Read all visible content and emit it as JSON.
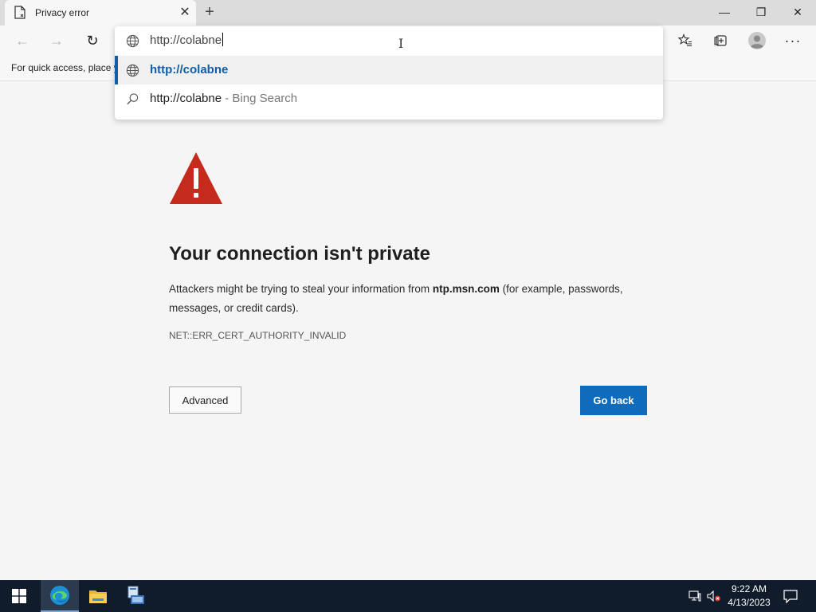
{
  "tab": {
    "title": "Privacy error",
    "close": "✕",
    "new_tab": "+"
  },
  "window": {
    "minimize": "—",
    "restore": "❐",
    "close": "✕"
  },
  "toolbar": {
    "back": "←",
    "forward": "→",
    "refresh": "↻",
    "more": "···"
  },
  "address_bar": {
    "value": "http://colabne"
  },
  "suggestions": [
    {
      "text": "http://colabne",
      "suffix": "",
      "type": "url",
      "selected": true
    },
    {
      "text": "http://colabne",
      "suffix": " - Bing Search",
      "type": "search",
      "selected": false
    }
  ],
  "favorites_bar": {
    "text": "For quick access, place y"
  },
  "page": {
    "headline": "Your connection isn't private",
    "desc_before": "Attackers might be trying to steal your information from ",
    "desc_host": "ntp.msn.com",
    "desc_after": " (for example, passwords, messages, or credit cards).",
    "error_code": "NET::ERR_CERT_AUTHORITY_INVALID",
    "advanced_label": "Advanced",
    "go_back_label": "Go back"
  },
  "taskbar": {
    "time": "9:22 AM",
    "date": "4/13/2023"
  },
  "colors": {
    "accent": "#0f6cbd",
    "warning": "#c42b1c",
    "taskbar": "#101c2b"
  }
}
